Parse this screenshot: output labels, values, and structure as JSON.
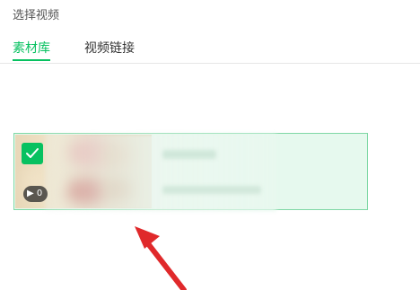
{
  "dialog": {
    "title": "选择视频"
  },
  "tabs": [
    {
      "label": "素材库",
      "active": true
    },
    {
      "label": "视频链接",
      "active": false
    }
  ],
  "video_card": {
    "selected": true,
    "duration_label": "0"
  },
  "colors": {
    "accent": "#07c160",
    "selected_bg": "#e6f9ee",
    "selected_border": "#7fd8a5",
    "annotation_arrow": "#e0292b"
  },
  "icons": [
    "checkmark-icon",
    "play-icon",
    "annotation-arrow"
  ]
}
